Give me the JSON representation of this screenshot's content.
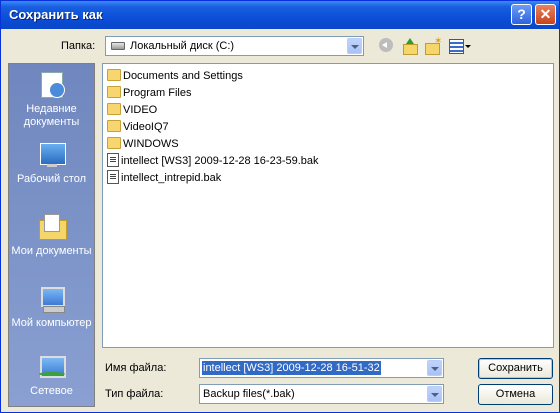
{
  "title": "Сохранить как",
  "titlebar_buttons": {
    "help": "?",
    "close": "✕"
  },
  "toolbar": {
    "look_in_label": "Папка:",
    "look_in_value": "Локальный диск (C:)",
    "icons": [
      "back-icon",
      "up-folder-icon",
      "new-folder-icon",
      "views-menu-icon"
    ]
  },
  "places": [
    {
      "label": "Недавние документы",
      "icon": "recent-documents-icon"
    },
    {
      "label": "Рабочий стол",
      "icon": "desktop-icon"
    },
    {
      "label": "Мои документы",
      "icon": "my-documents-icon"
    },
    {
      "label": "Мой компьютер",
      "icon": "my-computer-icon"
    },
    {
      "label": "Сетевое",
      "icon": "network-icon"
    }
  ],
  "files": [
    {
      "name": "Documents and Settings",
      "type": "folder"
    },
    {
      "name": "Program Files",
      "type": "folder"
    },
    {
      "name": "VIDEO",
      "type": "folder"
    },
    {
      "name": "VideoIQ7",
      "type": "folder"
    },
    {
      "name": "WINDOWS",
      "type": "folder"
    },
    {
      "name": "intellect [WS3] 2009-12-28 16-23-59.bak",
      "type": "bak"
    },
    {
      "name": "intellect_intrepid.bak",
      "type": "bak"
    }
  ],
  "filename": {
    "label": "Имя файла:",
    "value": "intellect [WS3] 2009-12-28 16-51-32"
  },
  "filetype": {
    "label": "Тип файла:",
    "value": "Backup files(*.bak)"
  },
  "buttons": {
    "save": "Сохранить",
    "cancel": "Отмена"
  },
  "colors": {
    "titlebar": "#0b4ed8",
    "places_bg": "#7b95c9",
    "selection": "#316ac5"
  }
}
